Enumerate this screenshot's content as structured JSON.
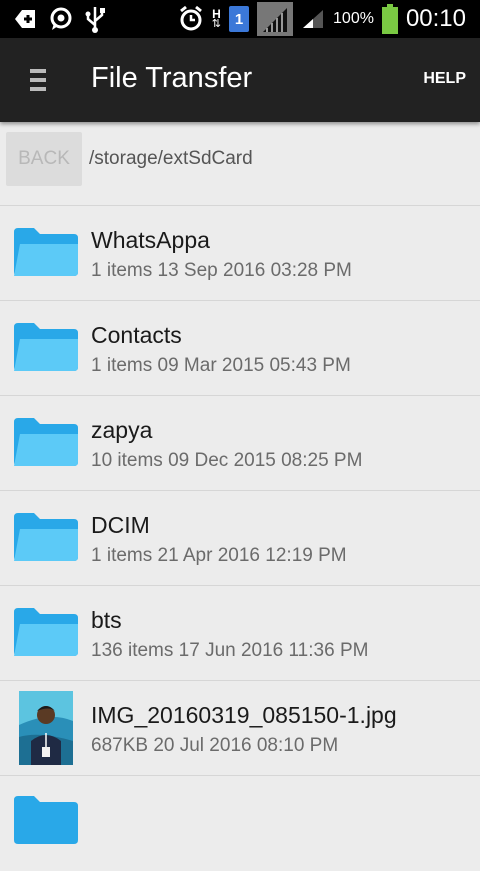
{
  "status_bar": {
    "battery_percent": "100%",
    "time": "00:10",
    "sim_label": "1",
    "network_label": "H"
  },
  "app_bar": {
    "title": "File Transfer",
    "help_label": "HELP"
  },
  "path_bar": {
    "back_label": "BACK",
    "path": "/storage/extSdCard"
  },
  "files": [
    {
      "name": "WhatsAppa",
      "meta": "1 items 13 Sep 2016 03:28 PM",
      "type": "folder"
    },
    {
      "name": "Contacts",
      "meta": "1 items 09 Mar 2015 05:43 PM",
      "type": "folder"
    },
    {
      "name": "zapya",
      "meta": "10 items 09 Dec 2015 08:25 PM",
      "type": "folder"
    },
    {
      "name": "DCIM",
      "meta": "1 items 21 Apr 2016 12:19 PM",
      "type": "folder"
    },
    {
      "name": "bts",
      "meta": "136 items 17 Jun 2016 11:36 PM",
      "type": "folder"
    },
    {
      "name": "IMG_20160319_085150-1.jpg",
      "meta": "687KB 20 Jul 2016 08:10 PM",
      "type": "image"
    }
  ],
  "colors": {
    "folder": "#4fc3f7",
    "appbar": "#222222",
    "battery": "#7ac943"
  }
}
